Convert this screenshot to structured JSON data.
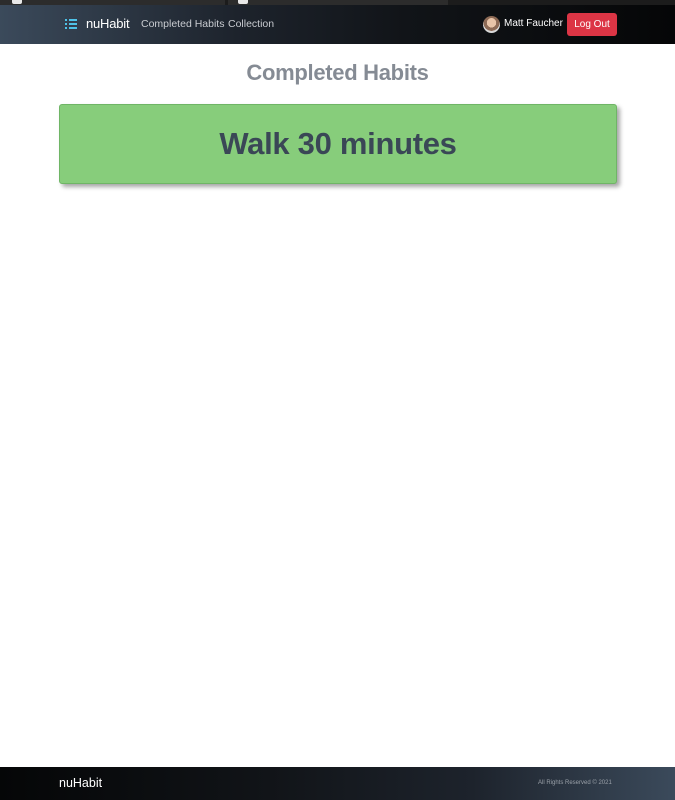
{
  "navbar": {
    "brand": "nuHabit",
    "links": [
      "Completed Habits",
      "Collection"
    ],
    "user_name": "Matt Faucher",
    "logout_label": "Log Out"
  },
  "main": {
    "title": "Completed Habits",
    "habits": [
      {
        "name": "Walk 30 minutes"
      }
    ]
  },
  "footer": {
    "brand": "nuHabit",
    "copyright": "All Rights Reserved © 2021"
  },
  "colors": {
    "logout": "#dc3545",
    "habit_card": "#87cd7b",
    "brand_icon": "#4fc3e8"
  },
  "icons": [
    "list-icon",
    "avatar"
  ]
}
